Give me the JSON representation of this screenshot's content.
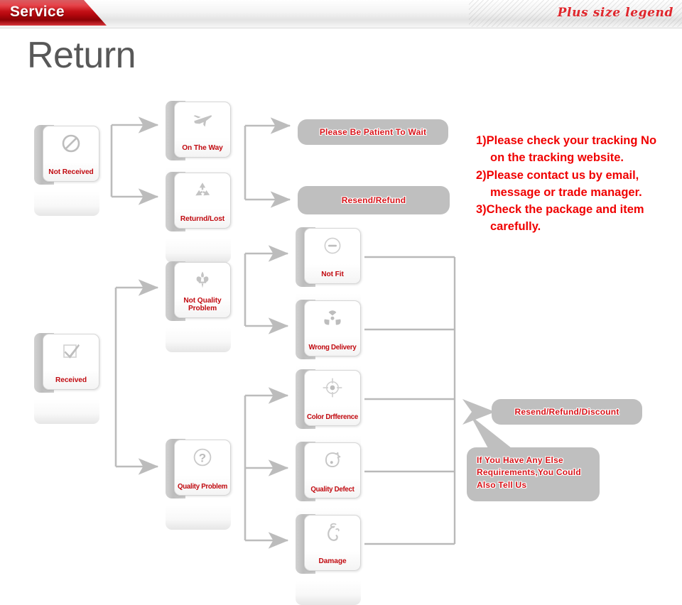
{
  "header": {
    "tab_label": "Service",
    "legend_label": "Plus size legend",
    "tab_color": "#c8161d",
    "legend_color": "#e0262c"
  },
  "page_title": "Return",
  "theme": {
    "label_red": "#c10a10",
    "note_red": "#f00000",
    "pill_gray": "#bfbfbf",
    "connector_gray": "#b5b5b5"
  },
  "nodes": [
    {
      "id": "not-received",
      "label": "Not Received",
      "icon": "prohibition-icon"
    },
    {
      "id": "on-the-way",
      "label": "On The Way",
      "icon": "airplane-icon"
    },
    {
      "id": "returnd-lost",
      "label": "Returnd/Lost",
      "icon": "recycle-icon"
    },
    {
      "id": "received",
      "label": "Received",
      "icon": "checkbox-check-icon"
    },
    {
      "id": "not-quality-problem",
      "label": "Not Quality\nProblem",
      "icon": "fleur-de-lis-icon"
    },
    {
      "id": "quality-problem",
      "label": "Quality Problem",
      "icon": "question-circle-icon"
    },
    {
      "id": "not-fit",
      "label": "Not Fit",
      "icon": "minus-circle-icon"
    },
    {
      "id": "wrong-delivery",
      "label": "Wrong Delivery",
      "icon": "radiation-icon"
    },
    {
      "id": "color-difference",
      "label": "Color Drfference",
      "icon": "crosshair-target-icon"
    },
    {
      "id": "quality-defect",
      "label": "Quality  Defect",
      "icon": "broken-circle-icon"
    },
    {
      "id": "damage",
      "label": "Damage",
      "icon": "ornament-swirl-icon"
    }
  ],
  "pills": {
    "patient": "Please  Be  Patient  To  Wait",
    "resend_refund": "Resend/Refund",
    "resend_refund_discount": "Resend/Refund/Discount",
    "tell_us_line1": "If You Have Any Else",
    "tell_us_line2": "Requirements,You Could",
    "tell_us_line3": "Also Tell Us"
  },
  "notes": [
    {
      "main": "1)Please check your tracking No",
      "cont": "on the tracking website."
    },
    {
      "main": "2)Please contact us by email,",
      "cont": "message or trade manager."
    },
    {
      "main": "3)Check the package and item",
      "cont": "carefully."
    }
  ]
}
